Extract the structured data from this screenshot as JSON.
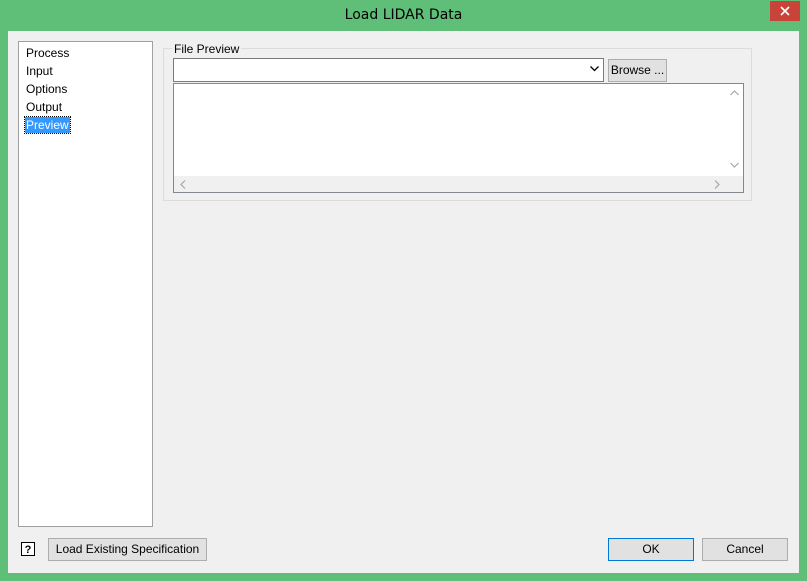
{
  "window": {
    "title": "Load LIDAR Data",
    "close_icon": "close-icon"
  },
  "nav": {
    "items": [
      {
        "label": "Process"
      },
      {
        "label": "Input"
      },
      {
        "label": "Options"
      },
      {
        "label": "Output"
      },
      {
        "label": "Preview",
        "selected": true
      }
    ]
  },
  "file_preview": {
    "group_label": "File Preview",
    "file_combo_value": "",
    "browse_label": "Browse ...",
    "preview_text": ""
  },
  "footer": {
    "help_icon": "help-icon",
    "load_spec_label": "Load Existing Specification",
    "ok_label": "OK",
    "cancel_label": "Cancel"
  },
  "colors": {
    "frame": "#5fbf78",
    "client": "#f0f0f0",
    "selection": "#3399ff",
    "close_button": "#c94438"
  }
}
